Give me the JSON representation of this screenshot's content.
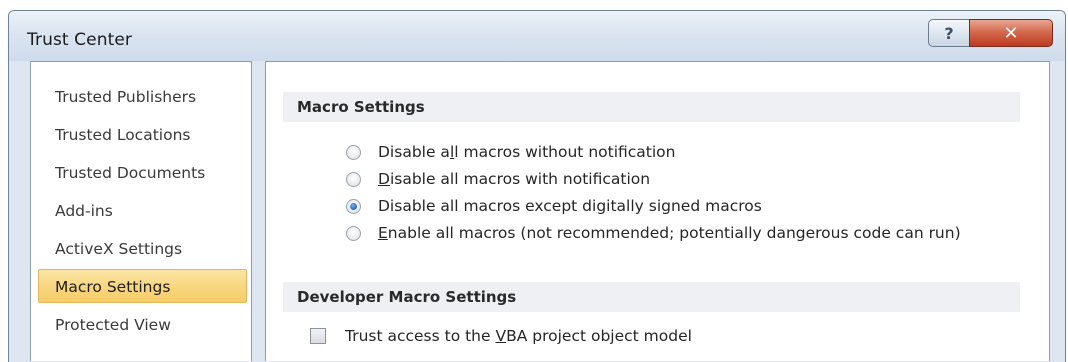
{
  "window": {
    "title": "Trust Center",
    "help_glyph": "?",
    "close_glyph": "✕"
  },
  "sidebar": {
    "selected": "Macro Settings",
    "items": [
      {
        "label": "Trusted Publishers"
      },
      {
        "label": "Trusted Locations"
      },
      {
        "label": "Trusted Documents"
      },
      {
        "label": "Add-ins"
      },
      {
        "label": "ActiveX Settings"
      },
      {
        "label": "Macro Settings"
      },
      {
        "label": "Protected View"
      }
    ]
  },
  "macro_settings": {
    "header": "Macro Settings",
    "selected_option": "Disable all macros except digitally signed macros",
    "options": [
      {
        "pre": "Disable a",
        "key": "l",
        "post": "l macros without notification",
        "checked": false
      },
      {
        "pre": "",
        "key": "D",
        "post": "isable all macros with notification",
        "checked": false
      },
      {
        "pre": "Disable all macros except di",
        "key": "g",
        "post": "itally signed macros",
        "checked": true
      },
      {
        "pre": "",
        "key": "E",
        "post": "nable all macros (not recommended; potentially dangerous code can run)",
        "checked": false
      }
    ]
  },
  "developer_macro_settings": {
    "header": "Developer Macro Settings",
    "trust_vba": {
      "pre": "Trust access to the ",
      "key": "V",
      "post": "BA project object model",
      "checked": false
    }
  },
  "colors": {
    "selected_nav": "#f8d479",
    "radio_checked": "#2f6fbf",
    "close_button": "#d46a4f"
  }
}
